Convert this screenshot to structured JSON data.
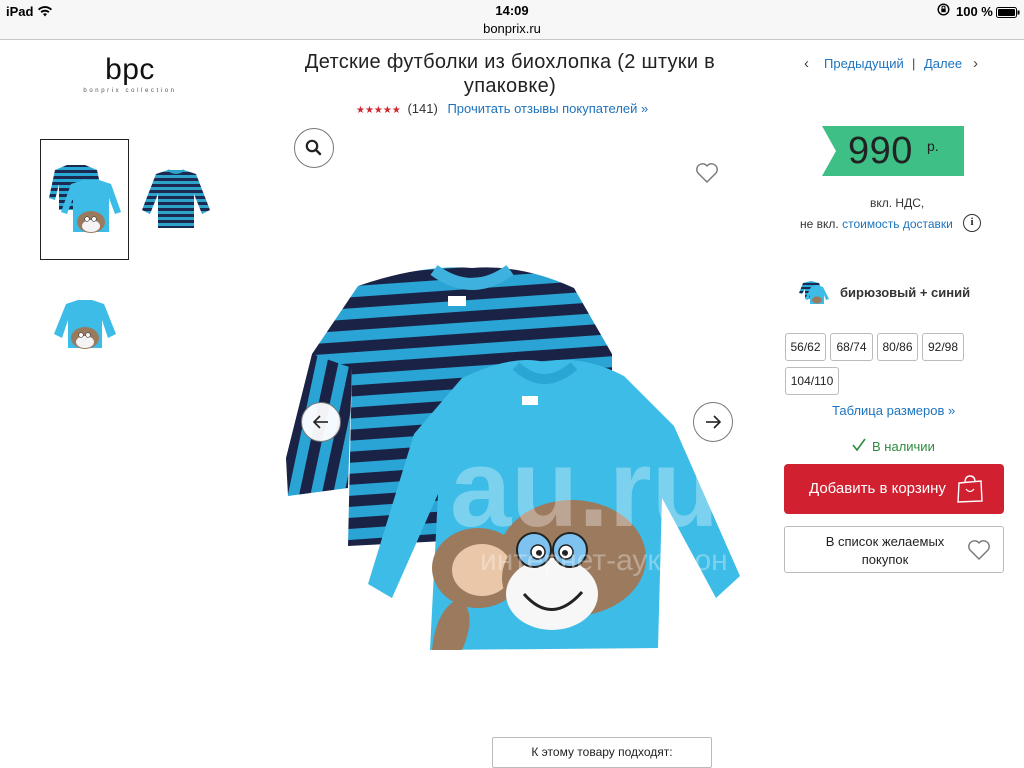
{
  "status_bar": {
    "device": "iPad",
    "wifi_icon": "wifi-icon",
    "time": "14:09",
    "domain": "bonprix.ru",
    "rotation_lock_icon": "rotation-lock-icon",
    "battery_text": "100 %",
    "battery_icon": "battery-icon"
  },
  "brand": {
    "logo_main": "bpc",
    "logo_sub": "bonprix collection"
  },
  "product": {
    "title": "Детские футболки из биохлопка (2 штуки в упаковке)",
    "rating_stars": "★★★★★",
    "rating_value": 5,
    "review_count": "(141)",
    "reviews_link": "Прочитать отзывы покупателей »"
  },
  "pager": {
    "prev": "Предыдущий",
    "separator": "|",
    "next": "Далее",
    "prev_icon": "chevron-left-icon",
    "next_icon": "chevron-right-icon"
  },
  "gallery": {
    "thumbnails": [
      "two-shirts-set",
      "striped-shirt",
      "monkey-shirt"
    ],
    "selected_index": 0,
    "zoom_icon": "search-icon",
    "wish_icon": "heart-icon",
    "left_arrow_icon": "arrow-left-icon",
    "right_arrow_icon": "arrow-right-icon"
  },
  "pricing": {
    "price": "990",
    "currency": "р.",
    "vat": "вкл. НДС,",
    "shipping_prefix": "не вкл.",
    "shipping_link": "стоимость доставки",
    "info_icon": "i",
    "flag_color": "#3dbf86"
  },
  "color": {
    "name": "бирюзовый + синий"
  },
  "sizes": [
    "56/62",
    "68/74",
    "80/86",
    "92/98",
    "104/110"
  ],
  "size_table_link": "Таблица размеров »",
  "stock": "В наличии",
  "actions": {
    "add_to_cart": "Добавить в корзину",
    "add_to_cart_color": "#d1202f",
    "wishlist": "В список желаемых покупок"
  },
  "related": "К этому товару подходят:"
}
